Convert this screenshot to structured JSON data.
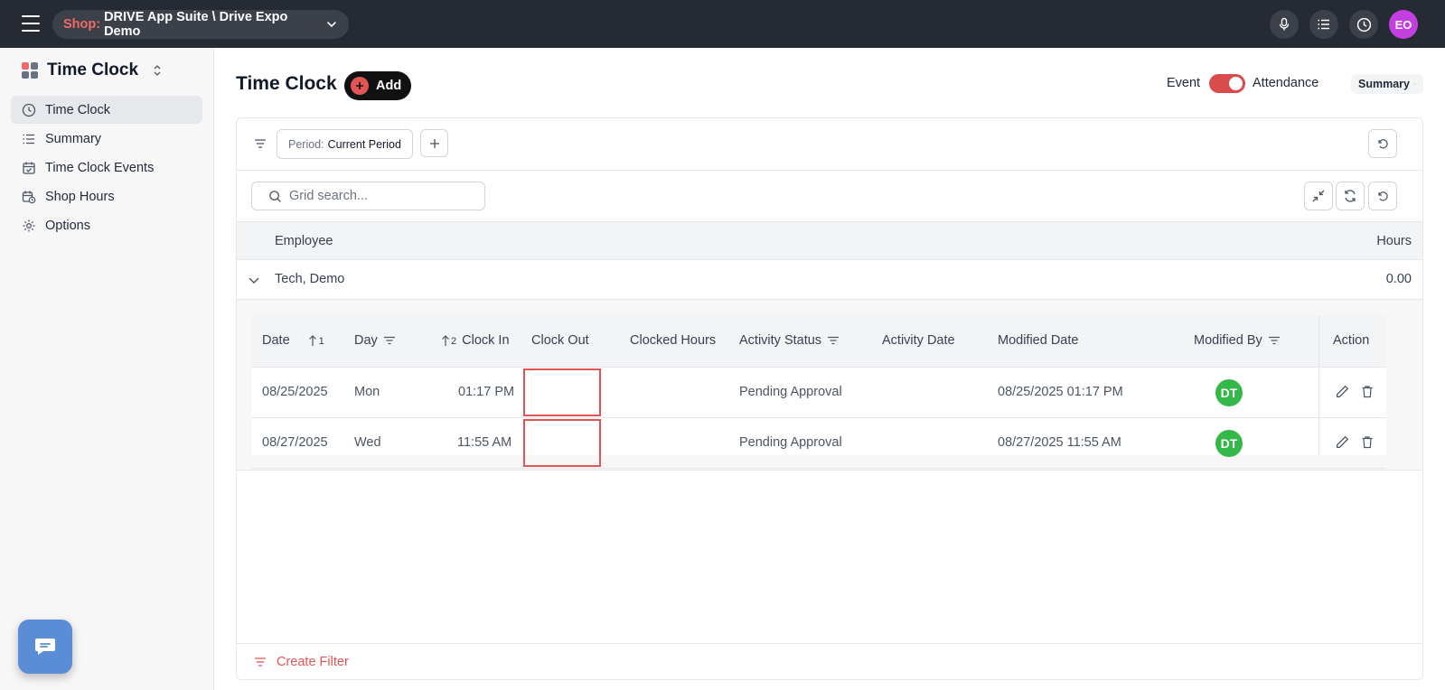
{
  "topbar": {
    "shop_label": "Shop:",
    "shop_name": "DRIVE App Suite \\ Drive Expo Demo",
    "user_initials": "EO",
    "user_avatar_color": "#c43fe0"
  },
  "sidebar": {
    "app_title": "Time Clock",
    "items": [
      {
        "label": "Time Clock",
        "icon": "clock-icon",
        "active": true
      },
      {
        "label": "Summary",
        "icon": "list-icon"
      },
      {
        "label": "Time Clock Events",
        "icon": "calendar-check-icon"
      },
      {
        "label": "Shop Hours",
        "icon": "calendar-clock-icon"
      },
      {
        "label": "Options",
        "icon": "gear-icon"
      }
    ]
  },
  "header": {
    "title": "Time Clock",
    "add_label": "Add",
    "event_label": "Event",
    "attendance_label": "Attendance",
    "toggle_on": true,
    "view_select": "Summary"
  },
  "filters": {
    "period_label": "Period:",
    "period_value": "Current Period"
  },
  "search": {
    "placeholder": "Grid search..."
  },
  "group_columns": {
    "employee": "Employee",
    "hours": "Hours"
  },
  "group": {
    "name": "Tech, Demo",
    "hours": "0.00"
  },
  "detail_columns": {
    "date": "Date",
    "date_sort_index": "1",
    "day": "Day",
    "clock_in_sort_index": "2",
    "clock_in": "Clock In",
    "clock_out": "Clock Out",
    "clocked_hours": "Clocked Hours",
    "activity_status": "Activity Status",
    "activity_date": "Activity Date",
    "modified_date": "Modified Date",
    "modified_by": "Modified By",
    "action": "Action"
  },
  "rows": [
    {
      "date": "08/25/2025",
      "day": "Mon",
      "clock_in": "01:17 PM",
      "clock_out": "",
      "clocked_hours": "",
      "activity_status": "Pending Approval",
      "activity_date": "",
      "modified_date": "08/25/2025 01:17 PM",
      "modified_by": "DT"
    },
    {
      "date": "08/27/2025",
      "day": "Wed",
      "clock_in": "11:55 AM",
      "clock_out": "",
      "clocked_hours": "",
      "activity_status": "Pending Approval",
      "activity_date": "",
      "modified_date": "08/27/2025 11:55 AM",
      "modified_by": "DT"
    }
  ],
  "footer": {
    "create_filter": "Create Filter"
  },
  "colors": {
    "accent": "#e05555",
    "topbar": "#262b33",
    "avatar_dt": "#35b84a"
  }
}
